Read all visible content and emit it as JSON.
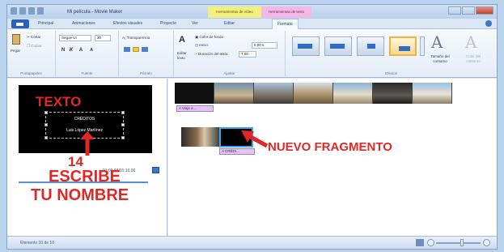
{
  "window": {
    "title": "Mi película - Movie Maker",
    "context_tabs": {
      "video": "Herramientas de vídeo",
      "text": "Herramientas de texto"
    }
  },
  "tabs": [
    {
      "label": "Principal"
    },
    {
      "label": "Animaciones"
    },
    {
      "label": "Efectos visuales"
    },
    {
      "label": "Proyecto"
    },
    {
      "label": "Ver"
    },
    {
      "label": "Editar"
    },
    {
      "label": "Formato"
    }
  ],
  "ribbon": {
    "clipboard": {
      "paste": "Pegar",
      "cut": "Cortar",
      "copy": "Copiar",
      "group": "Portapapeles"
    },
    "font": {
      "family": "Segoe UI",
      "size": "30",
      "bold": "N",
      "italic": "K",
      "grow": "A",
      "shrink": "A",
      "group": "Fuente"
    },
    "paragraph": {
      "transparency": "Transparencia",
      "group": "Párrafo"
    },
    "adjust": {
      "edit_text": "Editar texto",
      "bg_color": "Color de fondo",
      "start": "Inicio:",
      "start_value": "0,00 s",
      "duration": "Duración del texto:",
      "duration_value": "7,00",
      "group": "Ajustar"
    },
    "effects": {
      "outline_size": "Tamaño del contorno",
      "outline_color": "Color del contorno",
      "group": "Efectos"
    }
  },
  "preview": {
    "credit_line1": "CRÉDITOS",
    "credit_line2": "Luis López Martínez",
    "time": "01:03,03/01:10,00"
  },
  "storyboard": {
    "caption1": "A Viaje a ...",
    "caption2": "A CRÉDI..."
  },
  "status": {
    "text": "Elemento 10 de 10"
  },
  "annotations": {
    "texto": "TEXTO",
    "number": "14",
    "escribe": "ESCRIBE",
    "tu_nombre": "TU NOMBRE",
    "nuevo": "NUEVO FRAGMENTO"
  },
  "colors": {
    "annotation": "#e22727",
    "accent": "#3aa8f0"
  }
}
